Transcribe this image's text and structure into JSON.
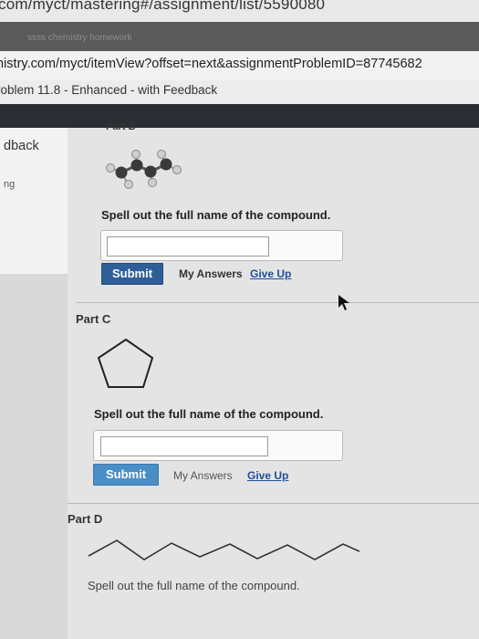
{
  "browser": {
    "top_url_fragment": "com/myct/mastering#/assignment/list/5590080",
    "tab_text": "ssss chemistry homework",
    "address": "nistry.com/myct/itemView?offset=next&assignmentProblemID=87745682"
  },
  "page": {
    "title": "roblem 11.8 - Enhanced - with Feedback"
  },
  "sidebar": {
    "heading": "dback",
    "sub": "ng"
  },
  "parts": {
    "b": {
      "label": "Part B",
      "question": "Spell out the full name of the compound.",
      "submit": "Submit",
      "my_answers": "My Answers",
      "give_up": "Give Up",
      "answer_value": ""
    },
    "c": {
      "label": "Part C",
      "question": "Spell out the full name of the compound.",
      "submit": "Submit",
      "my_answers": "My Answers",
      "give_up": "Give Up",
      "answer_value": ""
    },
    "d": {
      "label": "Part D",
      "question": "Spell out the full name of the compound."
    }
  },
  "colors": {
    "submit_bg": "#2e5f98",
    "link": "#1f4f9c",
    "dark_band": "#2a2d33"
  }
}
